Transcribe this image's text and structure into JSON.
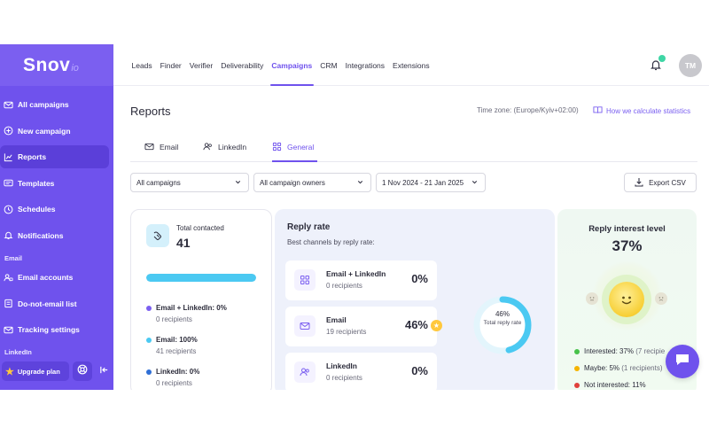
{
  "brand": {
    "logo": "Snov",
    "logo_sub": "io"
  },
  "sidebar": {
    "items": [
      {
        "label": "All campaigns",
        "icon": "mail-icon"
      },
      {
        "label": "New campaign",
        "icon": "plus-circle-icon"
      },
      {
        "label": "Reports",
        "icon": "chart-icon"
      },
      {
        "label": "Templates",
        "icon": "template-icon"
      },
      {
        "label": "Schedules",
        "icon": "clock-icon"
      },
      {
        "label": "Notifications",
        "icon": "bell-icon"
      }
    ],
    "section_email": "Email",
    "email_items": [
      {
        "label": "Email accounts",
        "icon": "accounts-icon"
      },
      {
        "label": "Do-not-email list",
        "icon": "list-icon"
      },
      {
        "label": "Tracking settings",
        "icon": "tracking-icon"
      }
    ],
    "section_linkedin": "LinkedIn",
    "upgrade_label": "Upgrade plan"
  },
  "topnav": {
    "links": [
      "Leads",
      "Finder",
      "Verifier",
      "Deliverability",
      "Campaigns",
      "CRM",
      "Integrations",
      "Extensions"
    ],
    "avatar": "TM"
  },
  "page": {
    "title": "Reports",
    "timezone": "Time zone: (Europe/Kyiv+02:00)",
    "how_link": "How we calculate statistics",
    "tabs": [
      "Email",
      "LinkedIn",
      "General"
    ]
  },
  "filters": {
    "campaigns": "All campaigns",
    "owners": "All campaign owners",
    "date_range": "1 Nov 2024 - 21 Jan 2025",
    "export": "Export CSV"
  },
  "total_contacted": {
    "label": "Total contacted",
    "value": "41",
    "bar_fill_fraction": 1.0,
    "legend": [
      {
        "title": "Email + LinkedIn: 0%",
        "sub": "0 recipients",
        "color": "#7b5ff0"
      },
      {
        "title": "Email: 100%",
        "sub": "41 recipients",
        "color": "#4bc9f2"
      },
      {
        "title": "LinkedIn: 0%",
        "sub": "0 recipients",
        "color": "#2f6fd6"
      }
    ]
  },
  "reply_rate": {
    "title": "Reply rate",
    "subtitle": "Best channels by reply rate:",
    "channels": [
      {
        "name": "Email + LinkedIn",
        "sub": "0 recipients",
        "pct": "0%"
      },
      {
        "name": "Email",
        "sub": "19 recipients",
        "pct": "46%"
      },
      {
        "name": "LinkedIn",
        "sub": "0 recipients",
        "pct": "0%"
      }
    ],
    "donut_value": "46%",
    "donut_label": "Total reply rate",
    "donut_fraction": 0.46,
    "donut_color": "#4bc9f2"
  },
  "reply_interest": {
    "title": "Reply interest level",
    "value": "37%",
    "legend": [
      {
        "label": "Interested: 37%",
        "extra": " (7 recipie",
        "color": "#47c24a"
      },
      {
        "label": "Maybe: 5%",
        "extra": " (1 recipients)",
        "color": "#f5b400"
      },
      {
        "label": "Not interested: 11%",
        "extra": "",
        "color": "#e0413a"
      }
    ]
  }
}
